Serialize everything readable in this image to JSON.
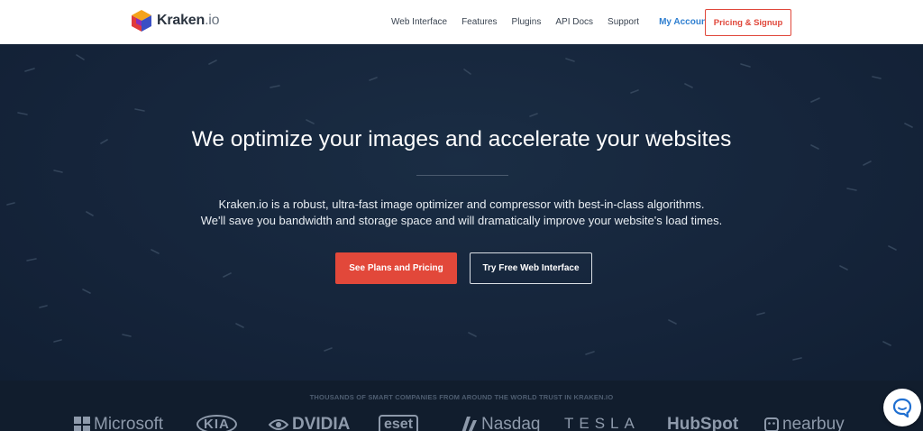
{
  "header": {
    "logo": {
      "name": "Kraken",
      "tld": ".io"
    },
    "nav": [
      {
        "label": "Web Interface"
      },
      {
        "label": "Features"
      },
      {
        "label": "Plugins"
      },
      {
        "label": "API Docs"
      },
      {
        "label": "Support"
      }
    ],
    "account_label": "My Account",
    "signup_label": "Pricing & Signup"
  },
  "hero": {
    "headline": "We optimize your images and accelerate your websites",
    "subline1": "Kraken.io is a robust, ultra-fast image optimizer and compressor with best-in-class algorithms.",
    "subline2": "We'll save you bandwidth and storage space and will dramatically improve your website's load times.",
    "primary_button": "See Plans and Pricing",
    "secondary_button": "Try Free Web Interface"
  },
  "trust": {
    "title": "THOUSANDS OF SMART COMPANIES FROM AROUND THE WORLD TRUST IN KRAKEN.IO",
    "brands": [
      {
        "name": "Microsoft",
        "icon": "windows-grid-icon"
      },
      {
        "name": "KIA",
        "icon": ""
      },
      {
        "name": "DVIDIA",
        "icon": "nvidia-eye-icon"
      },
      {
        "name": "eset",
        "icon": ""
      },
      {
        "name": "Nasdaq",
        "icon": "nasdaq-chevron-icon"
      },
      {
        "name": "TESLA",
        "icon": ""
      },
      {
        "name": "HubSpot",
        "icon": ""
      },
      {
        "name": "nearbuy",
        "icon": "nearbuy-face-icon"
      }
    ]
  },
  "colors": {
    "accent": "#e2483a",
    "link_blue": "#2f7fd0",
    "hero_bg": "#16263a"
  },
  "chat": {
    "icon": "chat-bubble-icon"
  }
}
